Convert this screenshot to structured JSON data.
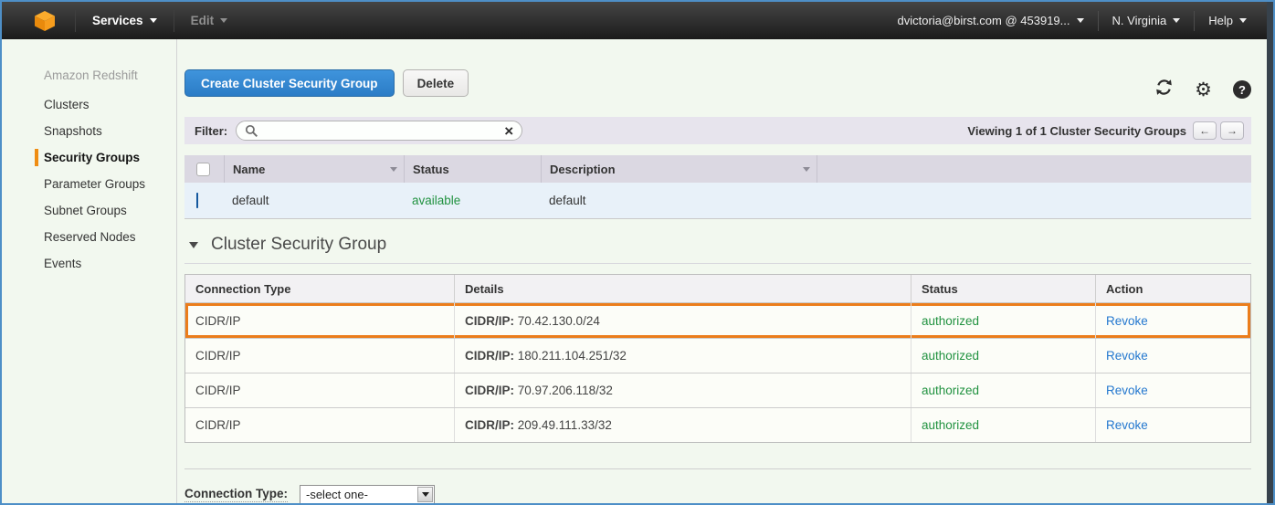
{
  "topbar": {
    "services_label": "Services",
    "edit_label": "Edit",
    "account_label": "dvictoria@birst.com @ 453919...",
    "region_label": "N. Virginia",
    "help_label": "Help"
  },
  "sidebar": {
    "heading": "Amazon Redshift",
    "items": [
      {
        "label": "Clusters",
        "active": false
      },
      {
        "label": "Snapshots",
        "active": false
      },
      {
        "label": "Security Groups",
        "active": true
      },
      {
        "label": "Parameter Groups",
        "active": false
      },
      {
        "label": "Subnet Groups",
        "active": false
      },
      {
        "label": "Reserved Nodes",
        "active": false
      },
      {
        "label": "Events",
        "active": false
      }
    ]
  },
  "toolbar": {
    "create_label": "Create Cluster Security Group",
    "delete_label": "Delete"
  },
  "filter": {
    "label": "Filter:",
    "search_value": "",
    "clear_label": "×",
    "viewing_text": "Viewing 1 of 1 Cluster Security Groups",
    "prev_label": "←",
    "next_label": "→"
  },
  "groups_table": {
    "columns": [
      {
        "label": "Name",
        "sortable": true
      },
      {
        "label": "Status",
        "sortable": false
      },
      {
        "label": "Description",
        "sortable": true
      }
    ],
    "rows": [
      {
        "name": "default",
        "status": "available",
        "description": "default",
        "selected": true
      }
    ]
  },
  "section": {
    "title": "Cluster Security Group"
  },
  "connections_table": {
    "columns": [
      "Connection Type",
      "Details",
      "Status",
      "Action"
    ],
    "rows": [
      {
        "connection_type": "CIDR/IP",
        "details_label": "CIDR/IP:",
        "details_value": "70.42.130.0/24",
        "status": "authorized",
        "action": "Revoke",
        "highlighted": true
      },
      {
        "connection_type": "CIDR/IP",
        "details_label": "CIDR/IP:",
        "details_value": "180.211.104.251/32",
        "status": "authorized",
        "action": "Revoke",
        "highlighted": false
      },
      {
        "connection_type": "CIDR/IP",
        "details_label": "CIDR/IP:",
        "details_value": "70.97.206.118/32",
        "status": "authorized",
        "action": "Revoke",
        "highlighted": false
      },
      {
        "connection_type": "CIDR/IP",
        "details_label": "CIDR/IP:",
        "details_value": "209.49.111.33/32",
        "status": "authorized",
        "action": "Revoke",
        "highlighted": false
      }
    ]
  },
  "footer": {
    "connection_type_label": "Connection Type:",
    "select_value": "-select one-"
  },
  "colors": {
    "accent_orange": "#ef8d13",
    "highlight_border": "#eb7d1b",
    "button_blue": "#2e83d4",
    "link_blue": "#2478cf",
    "status_green": "#219240",
    "selected_row": "#e8f1f9",
    "topbar_bg": "#232323",
    "page_bg": "#f2f8ef"
  }
}
